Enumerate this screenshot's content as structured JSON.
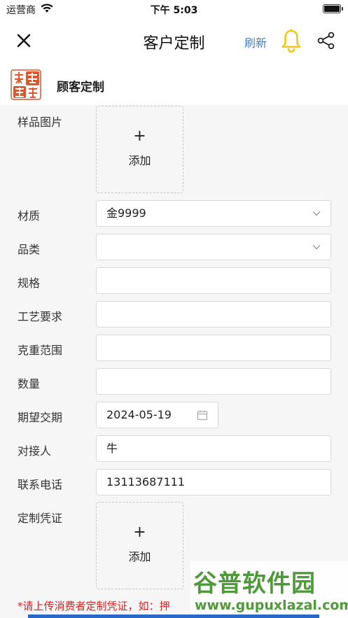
{
  "status_bar": {
    "carrier": "运营商",
    "time": "下午 5:03"
  },
  "nav": {
    "title": "客户定制",
    "refresh_label": "刷新"
  },
  "brand": {
    "name": "顾客定制"
  },
  "form": {
    "sample_image": {
      "label": "样品图片",
      "plus": "+",
      "add": "添加"
    },
    "material": {
      "label": "材质",
      "value": "金9999"
    },
    "category": {
      "label": "品类",
      "value": ""
    },
    "spec": {
      "label": "规格",
      "value": ""
    },
    "craft": {
      "label": "工艺要求",
      "value": ""
    },
    "weight_range": {
      "label": "克重范围",
      "value": ""
    },
    "quantity": {
      "label": "数量",
      "value": ""
    },
    "expected_date": {
      "label": "期望交期",
      "value": "2024-05-19"
    },
    "contact": {
      "label": "对接人",
      "value": "牛"
    },
    "phone": {
      "label": "联系电话",
      "value": "13113687111"
    },
    "voucher": {
      "label": "定制凭证",
      "plus": "+",
      "add": "添加"
    },
    "note": "*请上传消费者定制凭证，如：押"
  },
  "watermark": {
    "title": "谷普软件园",
    "url": "www.gupuxlazal.com"
  },
  "colors": {
    "accent": "#3c7fd0",
    "bell": "#f5c518",
    "note": "#e02020",
    "logo": "#e0562a"
  }
}
